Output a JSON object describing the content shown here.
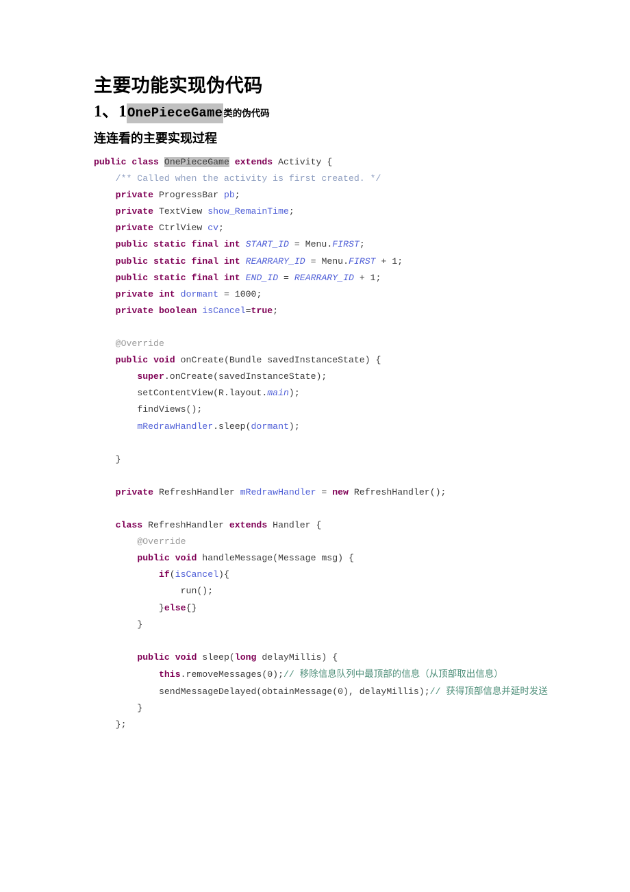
{
  "document": {
    "title": "主要功能实现伪代码",
    "section_heading": {
      "number": "1、1",
      "highlighted_term": "OnePieceGame",
      "suffix": "类的伪代码"
    },
    "subheading": "连连看的主要实现过程"
  },
  "code": {
    "language": "java",
    "lines": [
      {
        "id": "l01",
        "tokens": [
          {
            "t": "public",
            "c": "kw"
          },
          {
            "t": " ",
            "c": "plain"
          },
          {
            "t": "class",
            "c": "kw"
          },
          {
            "t": " ",
            "c": "plain"
          },
          {
            "t": "OnePieceGame",
            "c": "plain hl"
          },
          {
            "t": " ",
            "c": "plain"
          },
          {
            "t": "extends",
            "c": "kw"
          },
          {
            "t": " Activity {",
            "c": "plain"
          }
        ]
      },
      {
        "id": "l02",
        "indent": 4,
        "tokens": [
          {
            "t": "/** Called when the activity is first created. */",
            "c": "cmt"
          }
        ]
      },
      {
        "id": "l03",
        "indent": 4,
        "tokens": [
          {
            "t": "private",
            "c": "kw"
          },
          {
            "t": " ProgressBar ",
            "c": "plain"
          },
          {
            "t": "pb",
            "c": "fld"
          },
          {
            "t": ";",
            "c": "plain"
          }
        ]
      },
      {
        "id": "l04",
        "indent": 4,
        "tokens": [
          {
            "t": "private",
            "c": "kw"
          },
          {
            "t": " TextView ",
            "c": "plain"
          },
          {
            "t": "show_RemainTime",
            "c": "fld"
          },
          {
            "t": ";",
            "c": "plain"
          }
        ]
      },
      {
        "id": "l05",
        "indent": 4,
        "tokens": [
          {
            "t": "private",
            "c": "kw"
          },
          {
            "t": " CtrlView ",
            "c": "plain"
          },
          {
            "t": "cv",
            "c": "fld"
          },
          {
            "t": ";",
            "c": "plain"
          }
        ]
      },
      {
        "id": "l06",
        "indent": 4,
        "tokens": [
          {
            "t": "public",
            "c": "kw"
          },
          {
            "t": " ",
            "c": "plain"
          },
          {
            "t": "static",
            "c": "kw"
          },
          {
            "t": " ",
            "c": "plain"
          },
          {
            "t": "final",
            "c": "kw"
          },
          {
            "t": " ",
            "c": "plain"
          },
          {
            "t": "int",
            "c": "kw"
          },
          {
            "t": " ",
            "c": "plain"
          },
          {
            "t": "START_ID",
            "c": "stat"
          },
          {
            "t": " = Menu.",
            "c": "plain"
          },
          {
            "t": "FIRST",
            "c": "stat"
          },
          {
            "t": ";",
            "c": "plain"
          }
        ]
      },
      {
        "id": "l07",
        "indent": 4,
        "tokens": [
          {
            "t": "public",
            "c": "kw"
          },
          {
            "t": " ",
            "c": "plain"
          },
          {
            "t": "static",
            "c": "kw"
          },
          {
            "t": " ",
            "c": "plain"
          },
          {
            "t": "final",
            "c": "kw"
          },
          {
            "t": " ",
            "c": "plain"
          },
          {
            "t": "int",
            "c": "kw"
          },
          {
            "t": " ",
            "c": "plain"
          },
          {
            "t": "REARRARY_ID",
            "c": "stat"
          },
          {
            "t": " = Menu.",
            "c": "plain"
          },
          {
            "t": "FIRST",
            "c": "stat"
          },
          {
            "t": " + 1;",
            "c": "plain"
          }
        ]
      },
      {
        "id": "l08",
        "indent": 4,
        "tokens": [
          {
            "t": "public",
            "c": "kw"
          },
          {
            "t": " ",
            "c": "plain"
          },
          {
            "t": "static",
            "c": "kw"
          },
          {
            "t": " ",
            "c": "plain"
          },
          {
            "t": "final",
            "c": "kw"
          },
          {
            "t": " ",
            "c": "plain"
          },
          {
            "t": "int",
            "c": "kw"
          },
          {
            "t": " ",
            "c": "plain"
          },
          {
            "t": "END_ID",
            "c": "stat"
          },
          {
            "t": " = ",
            "c": "plain"
          },
          {
            "t": "REARRARY_ID",
            "c": "stat"
          },
          {
            "t": " + 1;",
            "c": "plain"
          }
        ]
      },
      {
        "id": "l09",
        "indent": 4,
        "tokens": [
          {
            "t": "private",
            "c": "kw"
          },
          {
            "t": " ",
            "c": "plain"
          },
          {
            "t": "int",
            "c": "kw"
          },
          {
            "t": " ",
            "c": "plain"
          },
          {
            "t": "dormant",
            "c": "fld"
          },
          {
            "t": " = 1000;",
            "c": "plain"
          }
        ]
      },
      {
        "id": "l10",
        "indent": 4,
        "tokens": [
          {
            "t": "private",
            "c": "kw"
          },
          {
            "t": " ",
            "c": "plain"
          },
          {
            "t": "boolean",
            "c": "kw"
          },
          {
            "t": " ",
            "c": "plain"
          },
          {
            "t": "isCancel",
            "c": "fld"
          },
          {
            "t": "=",
            "c": "plain"
          },
          {
            "t": "true",
            "c": "kw"
          },
          {
            "t": ";",
            "c": "plain"
          }
        ]
      },
      {
        "id": "l11",
        "blank": true,
        "tokens": []
      },
      {
        "id": "l12",
        "indent": 4,
        "tokens": [
          {
            "t": "@Override",
            "c": "ann"
          }
        ]
      },
      {
        "id": "l13",
        "indent": 4,
        "tokens": [
          {
            "t": "public",
            "c": "kw"
          },
          {
            "t": " ",
            "c": "plain"
          },
          {
            "t": "void",
            "c": "kw"
          },
          {
            "t": " onCreate(Bundle savedInstanceState) {",
            "c": "plain"
          }
        ]
      },
      {
        "id": "l14",
        "indent": 8,
        "tokens": [
          {
            "t": "super",
            "c": "kw"
          },
          {
            "t": ".onCreate(savedInstanceState);",
            "c": "plain"
          }
        ]
      },
      {
        "id": "l15",
        "indent": 8,
        "tokens": [
          {
            "t": "setContentView(R.layout.",
            "c": "plain"
          },
          {
            "t": "main",
            "c": "stat"
          },
          {
            "t": ");",
            "c": "plain"
          }
        ]
      },
      {
        "id": "l16",
        "indent": 8,
        "tokens": [
          {
            "t": "findViews();",
            "c": "plain"
          }
        ]
      },
      {
        "id": "l17",
        "indent": 8,
        "tokens": [
          {
            "t": "mRedrawHandler",
            "c": "fld"
          },
          {
            "t": ".sleep(",
            "c": "plain"
          },
          {
            "t": "dormant",
            "c": "fld"
          },
          {
            "t": ");",
            "c": "plain"
          }
        ]
      },
      {
        "id": "l18",
        "blank": true,
        "tokens": []
      },
      {
        "id": "l19",
        "indent": 4,
        "tokens": [
          {
            "t": "}",
            "c": "plain"
          }
        ]
      },
      {
        "id": "l20",
        "blank": true,
        "tokens": []
      },
      {
        "id": "l21",
        "indent": 4,
        "tokens": [
          {
            "t": "private",
            "c": "kw"
          },
          {
            "t": " RefreshHandler ",
            "c": "plain"
          },
          {
            "t": "mRedrawHandler",
            "c": "fld"
          },
          {
            "t": " = ",
            "c": "plain"
          },
          {
            "t": "new",
            "c": "kw"
          },
          {
            "t": " RefreshHandler();",
            "c": "plain"
          }
        ]
      },
      {
        "id": "l22",
        "blank": true,
        "tokens": []
      },
      {
        "id": "l23",
        "indent": 4,
        "tokens": [
          {
            "t": "class",
            "c": "kw"
          },
          {
            "t": " RefreshHandler ",
            "c": "plain"
          },
          {
            "t": "extends",
            "c": "kw"
          },
          {
            "t": " Handler {",
            "c": "plain"
          }
        ]
      },
      {
        "id": "l24",
        "indent": 8,
        "tokens": [
          {
            "t": "@Override",
            "c": "ann"
          }
        ]
      },
      {
        "id": "l25",
        "indent": 8,
        "tokens": [
          {
            "t": "public",
            "c": "kw"
          },
          {
            "t": " ",
            "c": "plain"
          },
          {
            "t": "void",
            "c": "kw"
          },
          {
            "t": " handleMessage(Message msg) {",
            "c": "plain"
          }
        ]
      },
      {
        "id": "l26",
        "indent": 12,
        "tokens": [
          {
            "t": "if",
            "c": "kw"
          },
          {
            "t": "(",
            "c": "plain"
          },
          {
            "t": "isCancel",
            "c": "fld"
          },
          {
            "t": "){",
            "c": "plain"
          }
        ]
      },
      {
        "id": "l27",
        "indent": 16,
        "tokens": [
          {
            "t": "run();",
            "c": "plain"
          }
        ]
      },
      {
        "id": "l28",
        "indent": 12,
        "tokens": [
          {
            "t": "}",
            "c": "plain"
          },
          {
            "t": "else",
            "c": "kw"
          },
          {
            "t": "{}",
            "c": "plain"
          }
        ]
      },
      {
        "id": "l29",
        "indent": 8,
        "tokens": [
          {
            "t": "}",
            "c": "plain"
          }
        ]
      },
      {
        "id": "l30",
        "blank": true,
        "tokens": []
      },
      {
        "id": "l31",
        "indent": 8,
        "tokens": [
          {
            "t": "public",
            "c": "kw"
          },
          {
            "t": " ",
            "c": "plain"
          },
          {
            "t": "void",
            "c": "kw"
          },
          {
            "t": " sleep(",
            "c": "plain"
          },
          {
            "t": "long",
            "c": "kw"
          },
          {
            "t": " delayMillis) {",
            "c": "plain"
          }
        ]
      },
      {
        "id": "l32",
        "indent": 12,
        "tokens": [
          {
            "t": "this",
            "c": "kw"
          },
          {
            "t": ".removeMessages(0);",
            "c": "plain"
          },
          {
            "t": "// ",
            "c": "cmt2"
          },
          {
            "t": "移除信息队列中最顶部的信息（从顶部取出信息）",
            "c": "cmt2 cn"
          }
        ]
      },
      {
        "id": "l33",
        "indent": 12,
        "tokens": [
          {
            "t": "sendMessageDelayed(obtainMessage(0), delayMillis);",
            "c": "plain"
          },
          {
            "t": "// ",
            "c": "cmt2"
          },
          {
            "t": "获得顶部信息并延时发送",
            "c": "cmt2 cn"
          }
        ]
      },
      {
        "id": "l34",
        "indent": 8,
        "tokens": [
          {
            "t": "}",
            "c": "plain"
          }
        ]
      },
      {
        "id": "l35",
        "indent": 4,
        "tokens": [
          {
            "t": "};",
            "c": "plain"
          }
        ]
      }
    ]
  },
  "colors": {
    "keyword": "#7f0055",
    "field_identifier": "#4f5fd7",
    "static_constant": "#4f5fd7",
    "javadoc_comment": "#8e9ec0",
    "annotation": "#9a9a9a",
    "line_comment": "#4f8f7a",
    "plain_code": "#3a3a3a",
    "highlight_background": "#c0c0c0",
    "page_background": "#ffffff"
  }
}
